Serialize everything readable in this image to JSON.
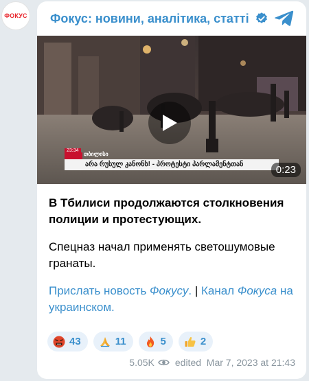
{
  "channel": {
    "avatar_text": "ФОКУС",
    "name": "Фокус: новини, аналітика, статті"
  },
  "video": {
    "duration": "0:23",
    "overlay_time": "23:34",
    "overlay_location": "თბილისი",
    "overlay_ticker": "არა რუსულ კანონს! - პროტესტი პარლამენტთან"
  },
  "post": {
    "headline": "В Тбилиси продолжаются столкновения полиции и протестующих.",
    "body": "Спецназ начал применять светошумовые гранаты.",
    "link1_text": "Прислать новость ",
    "link1_italic": "Фокусу",
    "link1_end": ".",
    "separator": " | ",
    "link2_text": "Канал ",
    "link2_italic": "Фокуса",
    "link2_end": " на украинском."
  },
  "reactions": [
    {
      "icon": "angry-face-icon",
      "emoji": "🤬",
      "count": "43"
    },
    {
      "icon": "praying-hands-icon",
      "emoji": "🙏",
      "count": "11"
    },
    {
      "icon": "fire-icon",
      "emoji": "🔥",
      "count": "5"
    },
    {
      "icon": "thumbs-up-icon",
      "emoji": "👍",
      "count": "2"
    }
  ],
  "meta": {
    "views": "5.05K",
    "edited": "edited  Mar 7, 2023 at 21:43"
  },
  "colors": {
    "accent": "#3a8fcc",
    "background": "#e5eaee",
    "avatar_red": "#e8232a"
  }
}
